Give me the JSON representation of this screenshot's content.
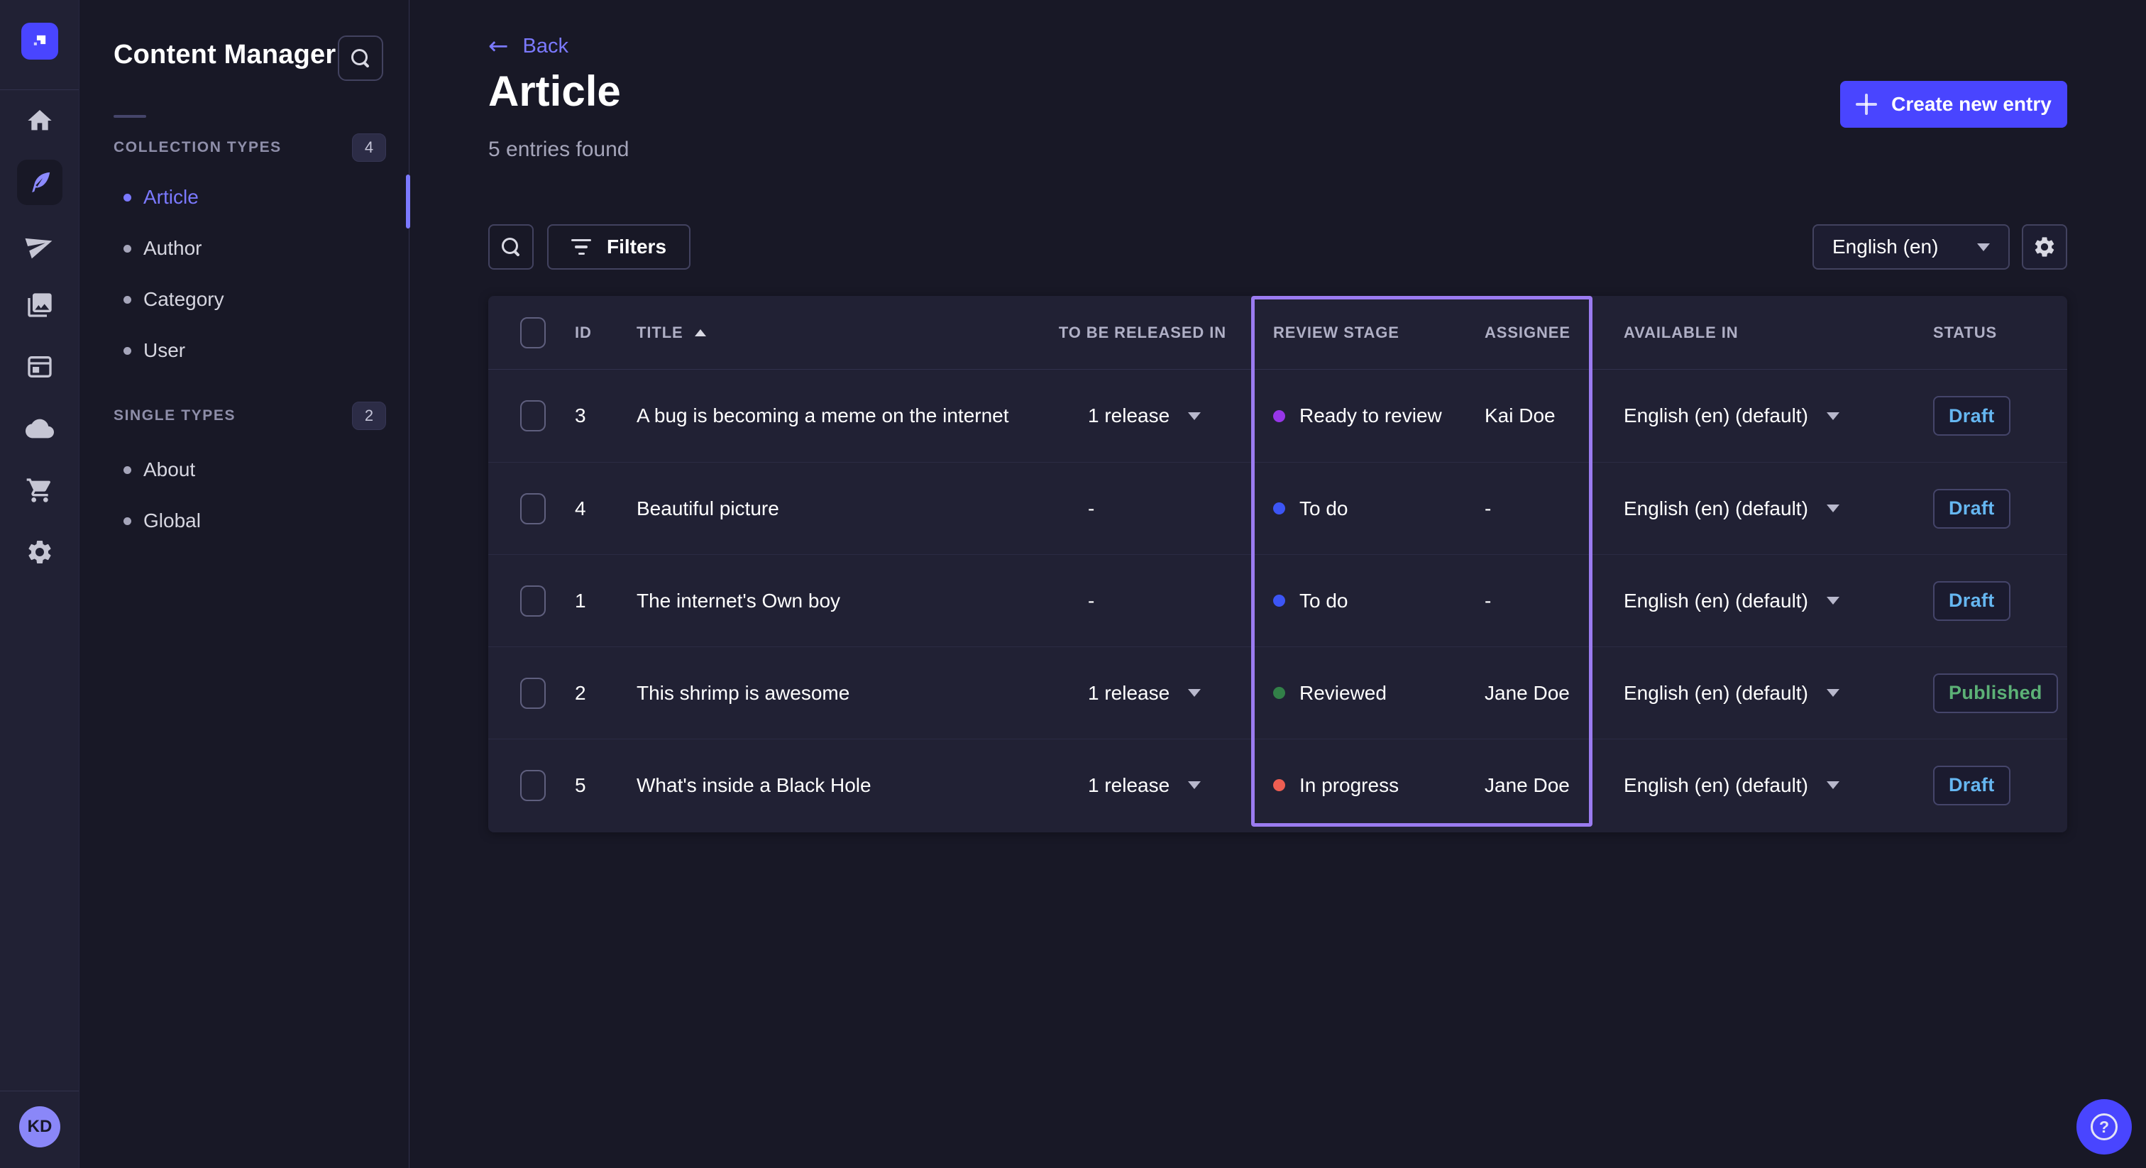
{
  "colors": {
    "accent": "#4945ff",
    "link": "#7b79ff",
    "highlight": "#9b7bf0",
    "draft_text": "#66b7f1",
    "published_text": "#5cb176"
  },
  "icon_rail": {
    "logo_icon": "strapi-logo",
    "items": [
      {
        "icon": "home",
        "state": ""
      },
      {
        "icon": "content-manager-feather",
        "state": "active"
      },
      {
        "icon": "releases-paper-plane",
        "state": ""
      },
      {
        "icon": "media-library-images",
        "state": ""
      },
      {
        "icon": "content-type-builder-layout",
        "state": ""
      },
      {
        "icon": "deploy-cloud",
        "state": ""
      },
      {
        "icon": "marketplace-cart",
        "state": ""
      },
      {
        "icon": "settings-gear",
        "state": ""
      }
    ],
    "avatar_initials": "KD"
  },
  "sidebar": {
    "title": "Content Manager",
    "search_icon": "search",
    "sections": [
      {
        "label": "COLLECTION TYPES",
        "count": "4",
        "items": [
          {
            "label": "Article",
            "state": "active"
          },
          {
            "label": "Author",
            "state": ""
          },
          {
            "label": "Category",
            "state": ""
          },
          {
            "label": "User",
            "state": ""
          }
        ]
      },
      {
        "label": "SINGLE TYPES",
        "count": "2",
        "items": [
          {
            "label": "About",
            "state": ""
          },
          {
            "label": "Global",
            "state": ""
          }
        ]
      }
    ]
  },
  "header": {
    "back_label": "Back",
    "back_arrow": "←",
    "title": "Article",
    "subtitle": "5 entries found",
    "create_label": "Create new entry"
  },
  "toolbar": {
    "search_icon": "search",
    "filters_label": "Filters",
    "locale_value": "English (en)",
    "settings_icon": "gear"
  },
  "table": {
    "columns": [
      {
        "label": "ID"
      },
      {
        "label": "TITLE",
        "sorted": "asc"
      },
      {
        "label": "TO BE RELEASED IN"
      },
      {
        "label": "REVIEW STAGE"
      },
      {
        "label": "ASSIGNEE"
      },
      {
        "label": "AVAILABLE IN"
      },
      {
        "label": "STATUS"
      }
    ],
    "rows": [
      {
        "id": "3",
        "title": "A bug is becoming a meme on the internet",
        "release": {
          "label": "1 release",
          "caret": ""
        },
        "stage": {
          "label": "Ready to review",
          "color": "#9736e8"
        },
        "assignee": "Kai Doe",
        "locale": "English (en) (default)",
        "status": {
          "label": "Draft",
          "kind": "status-draft"
        }
      },
      {
        "id": "4",
        "title": "Beautiful picture",
        "release": {
          "label": "-",
          "caret": "caret-hidden"
        },
        "stage": {
          "label": "To do",
          "color": "#3c55f5"
        },
        "assignee": "-",
        "locale": "English (en) (default)",
        "status": {
          "label": "Draft",
          "kind": "status-draft"
        }
      },
      {
        "id": "1",
        "title": "The internet's Own boy",
        "release": {
          "label": "-",
          "caret": "caret-hidden"
        },
        "stage": {
          "label": "To do",
          "color": "#3c55f5"
        },
        "assignee": "-",
        "locale": "English (en) (default)",
        "status": {
          "label": "Draft",
          "kind": "status-draft"
        }
      },
      {
        "id": "2",
        "title": "This shrimp is awesome",
        "release": {
          "label": "1 release",
          "caret": ""
        },
        "stage": {
          "label": "Reviewed",
          "color": "#328048"
        },
        "assignee": "Jane Doe",
        "locale": "English (en) (default)",
        "status": {
          "label": "Published",
          "kind": "status-published"
        }
      },
      {
        "id": "5",
        "title": "What's inside a Black Hole",
        "release": {
          "label": "1 release",
          "caret": ""
        },
        "stage": {
          "label": "In progress",
          "color": "#ee5e52"
        },
        "assignee": "Jane Doe",
        "locale": "English (en) (default)",
        "status": {
          "label": "Draft",
          "kind": "status-draft"
        }
      }
    ]
  },
  "annotation": {
    "highlight_color": "#9b7bf0"
  },
  "help": {
    "icon": "question-circle"
  }
}
